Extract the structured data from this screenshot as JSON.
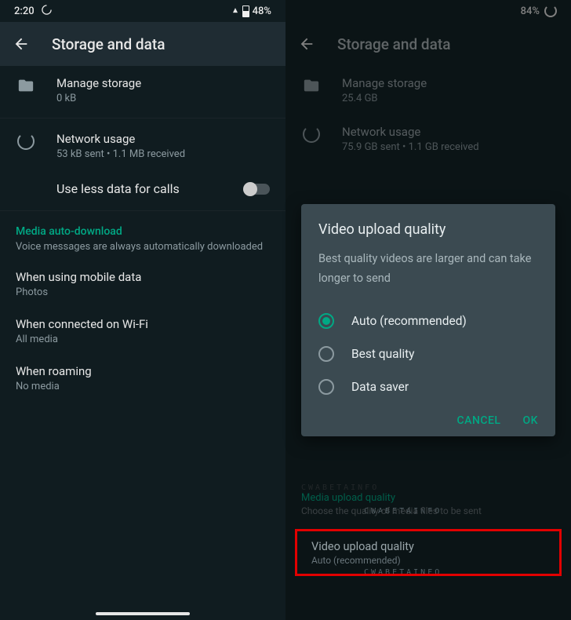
{
  "left": {
    "status": {
      "time": "2:20",
      "battery": "48%"
    },
    "title": "Storage and data",
    "manageStorage": {
      "label": "Manage storage",
      "sub": "0 kB"
    },
    "networkUsage": {
      "label": "Network usage",
      "sub": "53 kB sent • 1.1 MB received"
    },
    "lessData": {
      "label": "Use less data for calls"
    },
    "autoDownload": {
      "heading": "Media auto-download",
      "desc": "Voice messages are always automatically downloaded"
    },
    "mobileData": {
      "label": "When using mobile data",
      "sub": "Photos"
    },
    "wifi": {
      "label": "When connected on Wi-Fi",
      "sub": "All media"
    },
    "roaming": {
      "label": "When roaming",
      "sub": "No media"
    }
  },
  "right": {
    "status": {
      "battery": "84%"
    },
    "title": "Storage and data",
    "manageStorage": {
      "label": "Manage storage",
      "sub": "25.4 GB"
    },
    "networkUsage": {
      "label": "Network usage",
      "sub": "75.9 GB sent • 1.1 GB received"
    },
    "dialog": {
      "title": "Video upload quality",
      "desc": "Best quality videos are larger and can take longer to send",
      "options": [
        {
          "label": "Auto (recommended)",
          "selected": true
        },
        {
          "label": "Best quality",
          "selected": false
        },
        {
          "label": "Data saver",
          "selected": false
        }
      ],
      "cancel": "CANCEL",
      "ok": "OK"
    },
    "uploadSection": {
      "heading": "Media upload quality",
      "sub": "Choose the quality of media files to be sent"
    },
    "videoUpload": {
      "label": "Video upload quality",
      "sub": "Auto (recommended)"
    },
    "watermark": "CWABETAINFO"
  }
}
